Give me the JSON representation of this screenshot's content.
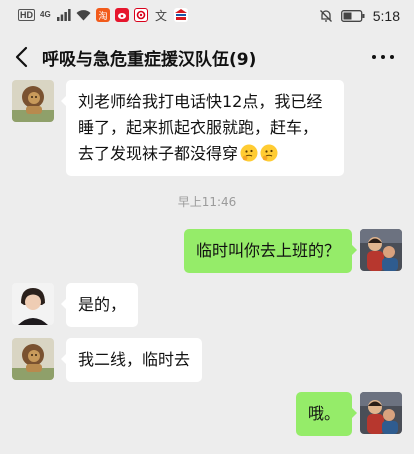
{
  "status_bar": {
    "hd_label": "HD",
    "network_label": "4G",
    "time": "5:18",
    "icons": [
      "hd-icon",
      "signal-icon",
      "wifi-icon",
      "taobao-icon",
      "weibo-icon",
      "netease-icon",
      "text-app-icon",
      "bank-icon",
      "mute-icon",
      "battery-icon"
    ]
  },
  "header": {
    "title": "呼吸与急危重症援汉队伍(9)",
    "back_icon": "back-arrow-icon",
    "more_icon": "more-dots-icon"
  },
  "chat": {
    "timestamp": "早上11:46",
    "messages": [
      {
        "side": "in",
        "avatar": "lion-avatar",
        "text": "刘老师给我打电话快12点，我已经睡了，起来抓起衣服就跑，赶车，去了发现袜子都没得穿",
        "emojis": [
          "thinking-emoji",
          "thinking-emoji"
        ]
      },
      {
        "side": "out",
        "avatar": "photo-avatar",
        "text": "临时叫你去上班的？"
      },
      {
        "side": "in",
        "avatar": "woman-avatar",
        "text": "是的，"
      },
      {
        "side": "in",
        "avatar": "lion-avatar",
        "text": "我二线，临时去"
      },
      {
        "side": "out",
        "avatar": "photo-avatar",
        "text": "哦。"
      }
    ]
  },
  "colors": {
    "background": "#EDEDED",
    "incoming_bubble": "#FFFFFF",
    "outgoing_bubble": "#95EC69",
    "timestamp_text": "#9B9B9B"
  }
}
